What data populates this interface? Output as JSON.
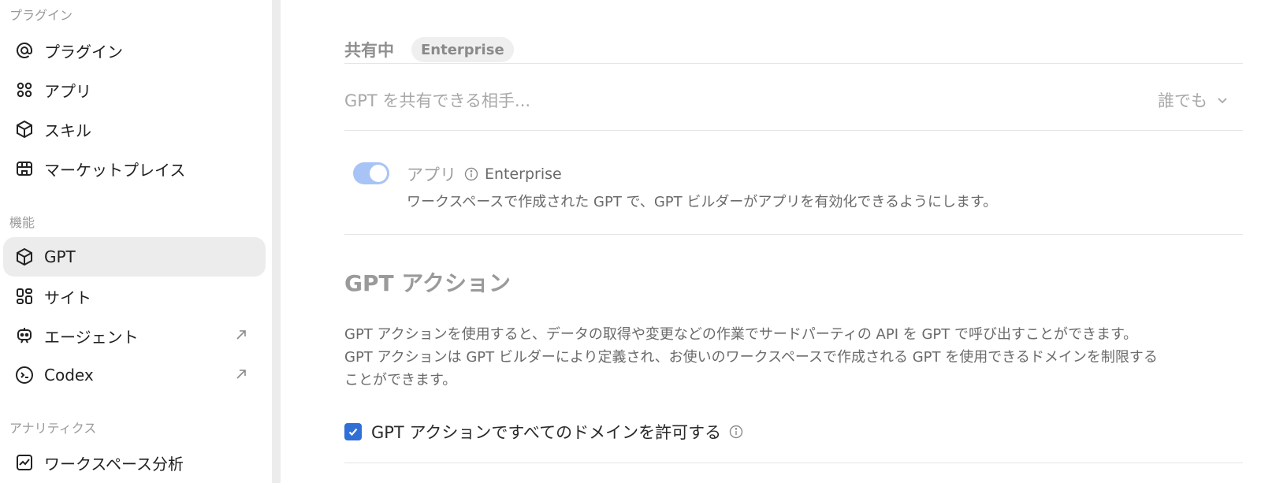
{
  "sidebar": {
    "sections": [
      {
        "label": "プラグイン"
      },
      {
        "label": "機能"
      },
      {
        "label": "アナリティクス"
      }
    ],
    "items": [
      {
        "label": "プラグイン",
        "icon": "at-icon"
      },
      {
        "label": "アプリ",
        "icon": "apps-icon"
      },
      {
        "label": "スキル",
        "icon": "skill-cube-icon"
      },
      {
        "label": "マーケットプレイス",
        "icon": "store-icon"
      },
      {
        "label": "GPT",
        "icon": "cube-icon",
        "active": true
      },
      {
        "label": "サイト",
        "icon": "site-grid-icon"
      },
      {
        "label": "エージェント",
        "icon": "agent-robot-icon",
        "external": true
      },
      {
        "label": "Codex",
        "icon": "codex-icon",
        "external": true
      },
      {
        "label": "ワークスペース分析",
        "icon": "chart-icon"
      }
    ]
  },
  "main": {
    "sharing": {
      "title": "共有中",
      "badge": "Enterprise",
      "row_label": "GPT を共有できる相手...",
      "select_value": "誰でも"
    },
    "apps_toggle": {
      "label": "アプリ",
      "badge": "Enterprise",
      "enabled": true,
      "description": "ワークスペースで作成された GPT で、GPT ビルダーがアプリを有効化できるようにします。"
    },
    "gpt_actions": {
      "heading": "GPT アクション",
      "paragraph_lines": [
        "GPT アクションを使用すると、データの取得や変更などの作業でサードパーティの API を GPT で呼び出すことができます。",
        "GPT アクションは GPT ビルダーにより定義され、お使いのワークスペースで作成される GPT を使用できるドメインを制限する",
        "ことができます。"
      ],
      "checkbox_label": "GPT アクションですべてのドメインを許可する",
      "checked": true
    }
  },
  "colors": {
    "accent": "#2f6fd6",
    "toggle_on": "#a8c3f6",
    "active_bg": "#ececec"
  }
}
